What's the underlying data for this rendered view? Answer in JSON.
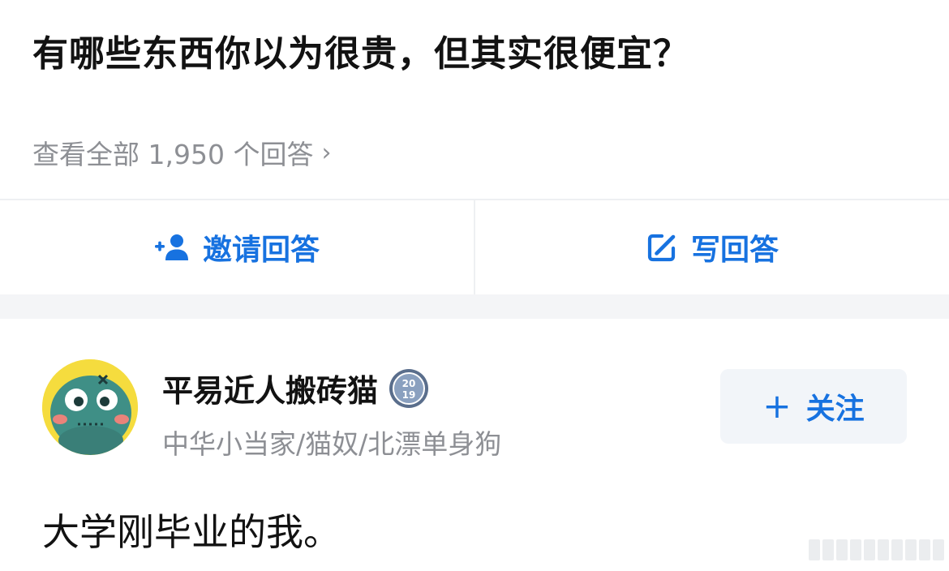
{
  "question": {
    "title": "有哪些东西你以为很贵，但其实很便宜？",
    "view_all": "查看全部 1,950 个回答",
    "view_all_chevron": "›"
  },
  "actions": {
    "invite_label": "邀请回答",
    "invite_icon": "add-user-icon",
    "write_label": "写回答",
    "write_icon": "edit-icon",
    "accent_color": "#1772e0"
  },
  "author": {
    "name": "平易近人搬砖猫",
    "badge_icon": "year-badge-icon",
    "badge_text_top": "20",
    "badge_text_bottom": "19",
    "bio": "中华小当家/猫奴/北漂单身狗",
    "follow_plus": "+",
    "follow_label": "关注"
  },
  "answer": {
    "text": "大学刚毕业的我。"
  }
}
